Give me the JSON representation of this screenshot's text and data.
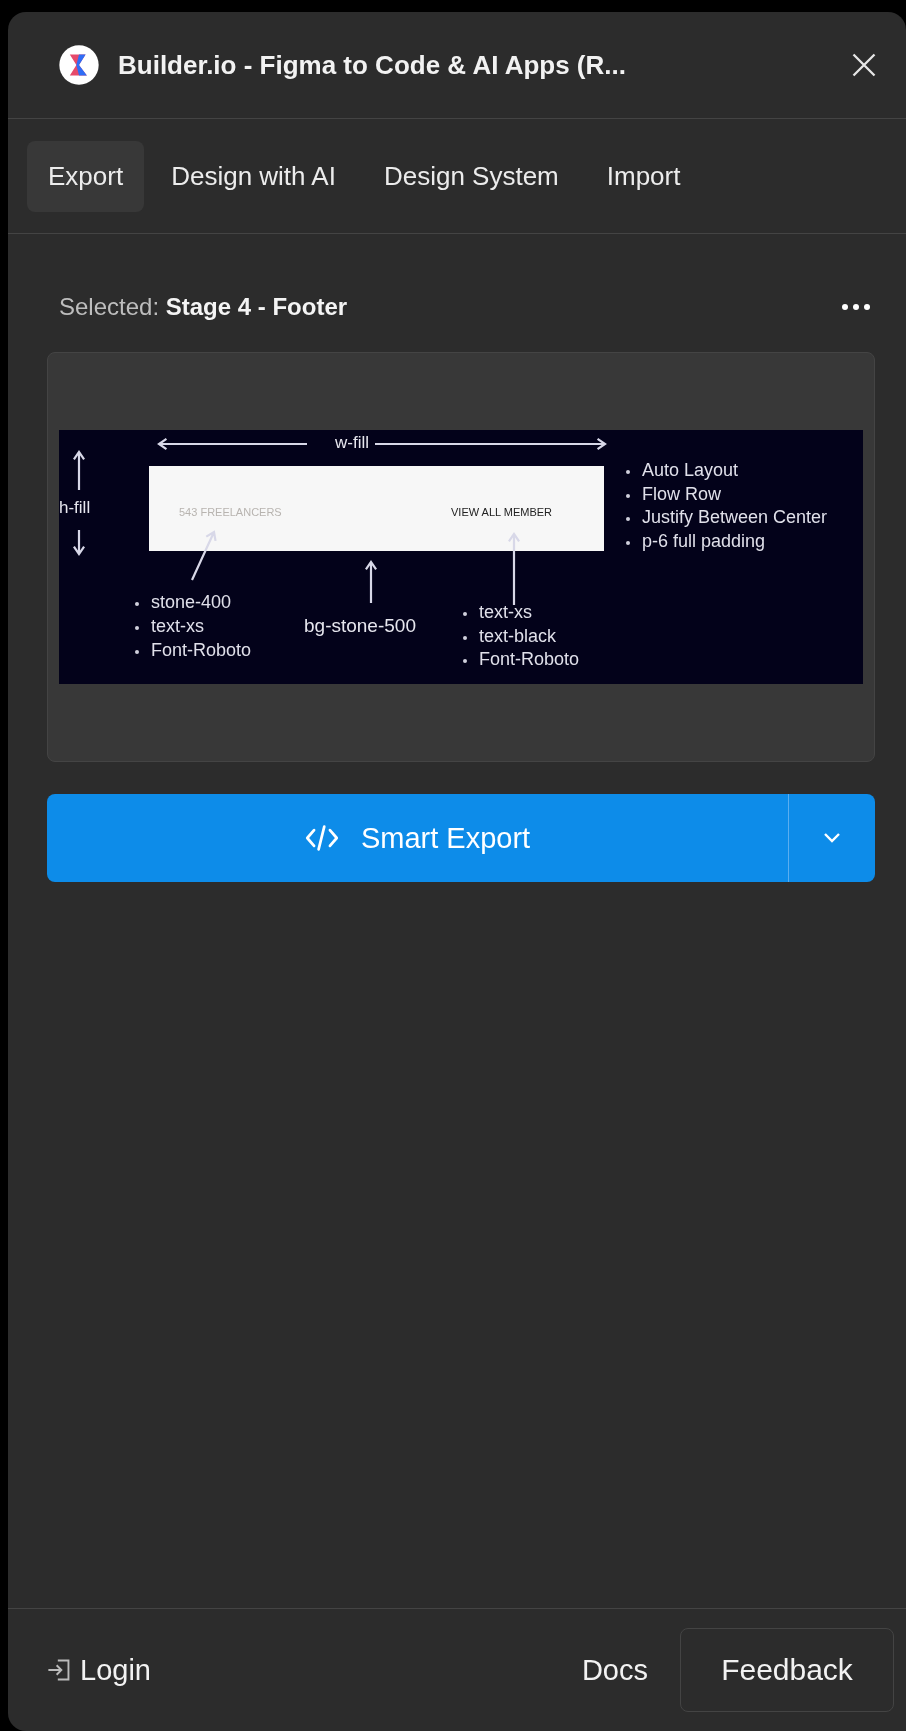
{
  "window": {
    "title": "Builder.io - Figma to Code & AI Apps (R..."
  },
  "tabs": [
    {
      "label": "Export",
      "selected": true
    },
    {
      "label": "Design with AI",
      "selected": false
    },
    {
      "label": "Design System",
      "selected": false
    },
    {
      "label": "Import",
      "selected": false
    }
  ],
  "selection": {
    "label": "Selected:",
    "value": "Stage 4 - Footer"
  },
  "preview": {
    "width_label": "w-fill",
    "height_label": "h-fill",
    "sample_left": "543 FREELANCERS",
    "sample_right": "VIEW ALL MEMBER",
    "center_label": "bg-stone-500",
    "left_notes": [
      "stone-400",
      "text-xs",
      "Font-Roboto"
    ],
    "right_notes": [
      "text-xs",
      "text-black",
      "Font-Roboto"
    ],
    "side_notes": [
      "Auto Layout",
      "Flow Row",
      "Justify Between Center",
      "p-6 full padding"
    ]
  },
  "export_button": {
    "label": "Smart Export"
  },
  "footer": {
    "login": "Login",
    "docs": "Docs",
    "feedback": "Feedback"
  }
}
